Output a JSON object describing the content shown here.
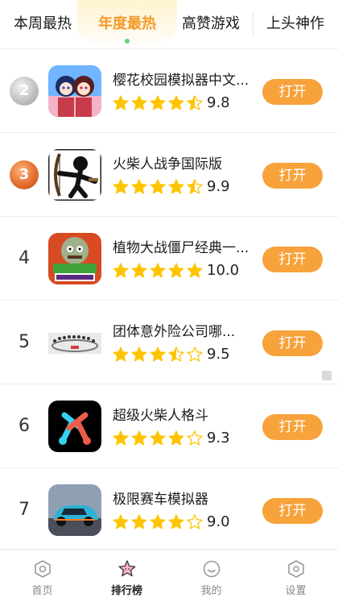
{
  "tabs": [
    {
      "label": "本周最热"
    },
    {
      "label": "年度最热"
    },
    {
      "label": "高赞游戏"
    },
    {
      "label": "上头神作"
    }
  ],
  "colors": {
    "accent": "#f7a23a",
    "star": "#ffc400",
    "active_tab": "#f59a2b"
  },
  "list": [
    {
      "rank": "",
      "medal": "silver",
      "medal_glyph": "2",
      "title": "樱花校园模拟器中文...",
      "rating": 4.5,
      "score": "9.8",
      "button": "打开",
      "icon": "anime-girls-icon"
    },
    {
      "rank": "",
      "medal": "bronze",
      "medal_glyph": "3",
      "title": "火柴人战争国际版",
      "rating": 4.5,
      "score": "9.9",
      "button": "打开",
      "icon": "stickman-archer-icon"
    },
    {
      "rank": "4",
      "title": "植物大战僵尸经典一...",
      "rating": 5,
      "score": "10.0",
      "button": "打开",
      "icon": "plants-vs-zombies-icon"
    },
    {
      "rank": "5",
      "title": "团体意外险公司哪...",
      "rating": 3.5,
      "score": "9.5",
      "button": "打开",
      "icon": "insurance-ad-icon"
    },
    {
      "rank": "6",
      "title": "超级火柴人格斗",
      "rating": 4,
      "score": "9.3",
      "button": "打开",
      "icon": "stickman-fight-icon"
    },
    {
      "rank": "7",
      "title": "极限赛车模拟器",
      "rating": 4,
      "score": "9.0",
      "button": "打开",
      "icon": "race-car-icon"
    }
  ],
  "nav": [
    {
      "label": "首页",
      "icon": "home-icon"
    },
    {
      "label": "排行榜",
      "icon": "ranking-star-icon"
    },
    {
      "label": "我的",
      "icon": "profile-smile-icon"
    },
    {
      "label": "设置",
      "icon": "settings-icon"
    }
  ]
}
